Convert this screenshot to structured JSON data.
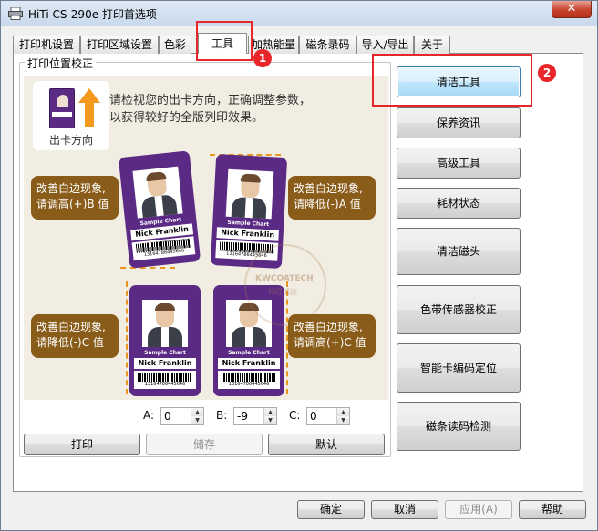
{
  "window": {
    "title": "HiTi CS-290e 打印首选项",
    "close_label": "✕"
  },
  "tabs": [
    {
      "label": "打印机设置"
    },
    {
      "label": "打印区域设置"
    },
    {
      "label": "色彩"
    },
    {
      "label": "工具",
      "active": true
    },
    {
      "label": "加热能量"
    },
    {
      "label": "磁条录码"
    },
    {
      "label": "导入/导出"
    },
    {
      "label": "关于"
    }
  ],
  "group": {
    "label": "打印位置校正"
  },
  "illustration": {
    "direction_label": "出卡方向",
    "intro_line1": "请检视您的出卡方向，正确调整参数，",
    "intro_line2": "以获得较好的全版列印效果。",
    "card_name": "Nick Franklin",
    "card_sample": "Sample Chart",
    "card_number": "13164786445646",
    "mini_card_name": "Nick Franklin",
    "bubble_top_left": {
      "line1": "改善白边现象,",
      "line2": "请调高(+)B 值"
    },
    "bubble_top_right": {
      "line1": "改善白边现象,",
      "line2": "请降低(-)A 值"
    },
    "bubble_bottom_left": {
      "line1": "改善白边现象,",
      "line2": "请降低(-)C 值"
    },
    "bubble_bottom_right": {
      "line1": "改善白边现象,",
      "line2": "请调高(+)C 值"
    },
    "watermark_main": "KWCOATECH",
    "watermark_sub": "科旺诚达"
  },
  "offsets": {
    "a": {
      "label": "A:",
      "value": "0"
    },
    "b": {
      "label": "B:",
      "value": "-9"
    },
    "c": {
      "label": "C:",
      "value": "0"
    }
  },
  "buttons": {
    "print": "打印",
    "save": "储存",
    "default": "默认",
    "clean_tool": "清洁工具",
    "maintenance_info": "保养资讯",
    "advanced_tools": "高级工具",
    "consumables_status": "耗材状态",
    "clean_magnetic_head": "清洁磁头",
    "ribbon_sensor_calibration": "色带传感器校正",
    "smartcard_encoding_position": "智能卡编码定位",
    "magstripe_read_test": "磁条读码检测",
    "ok": "确定",
    "cancel": "取消",
    "apply": "应用(A)",
    "help": "帮助"
  },
  "annotations": {
    "marker_1": "1",
    "marker_2": "2"
  },
  "colors": {
    "highlight": "#e8262a",
    "card_purple": "#5b2a85",
    "bubble_brown": "#8a5c1a",
    "dash_orange": "#e8961e"
  }
}
